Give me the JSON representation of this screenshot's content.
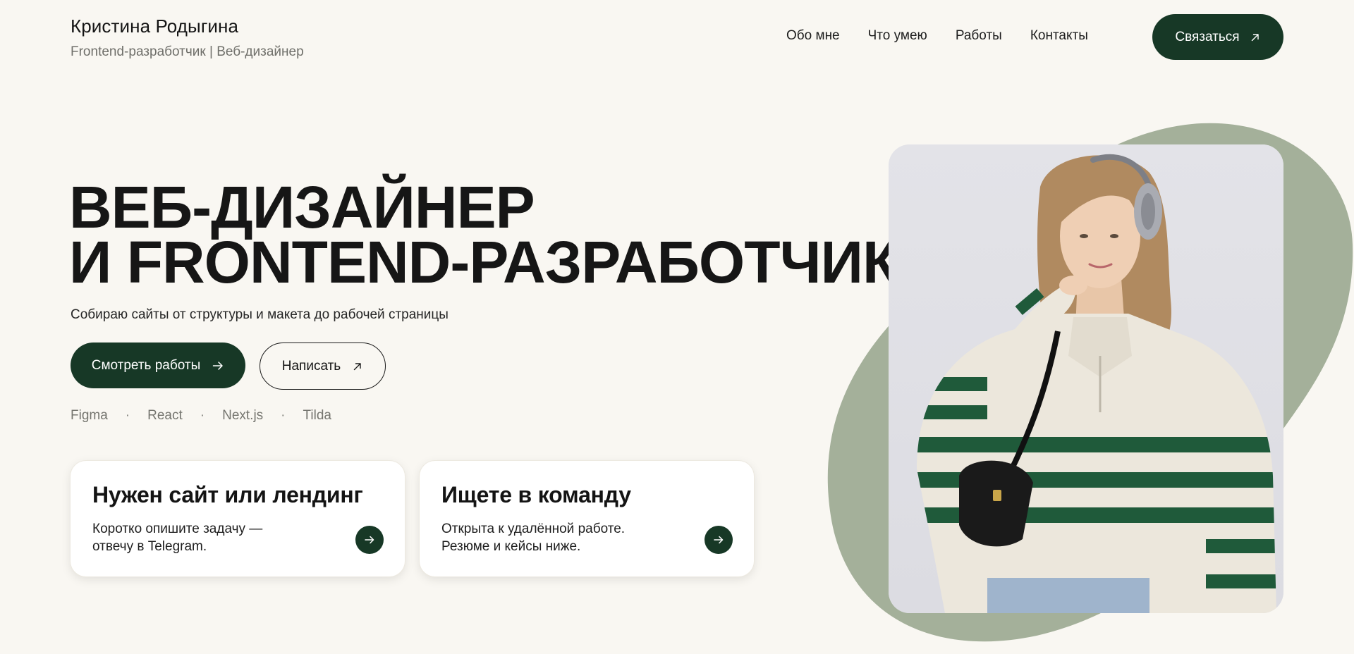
{
  "header": {
    "name": "Кристина Родыгина",
    "subtitle": "Frontend-разработчик | Веб-дизайнер",
    "nav": [
      "Обо мне",
      "Что умею",
      "Работы",
      "Контакты"
    ],
    "cta": "Связаться"
  },
  "hero": {
    "title_line1": "ВЕБ-ДИЗАЙНЕР",
    "title_line2": "И FRONTEND-РАЗРАБОТЧИК",
    "subtitle": "Собираю сайты от структуры и макета до рабочей страницы",
    "primary_button": "Смотреть работы",
    "secondary_button": "Написать",
    "tools": [
      "Figma",
      "React",
      "Next.js",
      "Tilda"
    ]
  },
  "cards": [
    {
      "title": "Нужен сайт или лендинг",
      "text_line1": "Коротко опишите задачу —",
      "text_line2": "отвечу в Telegram."
    },
    {
      "title": "Ищете в команду",
      "text_line1": "Открыта к удалённой работе.",
      "text_line2": "Резюме и кейсы ниже."
    }
  ],
  "colors": {
    "background": "#f9f7f2",
    "accent_dark_green": "#173826",
    "blob_sage": "#a4b09a",
    "muted_text": "#6f6f6a"
  },
  "icons": {
    "contact": "arrow-up-right-icon",
    "primary": "arrow-right-icon",
    "secondary": "arrow-up-right-icon",
    "card": "arrow-right-icon"
  }
}
